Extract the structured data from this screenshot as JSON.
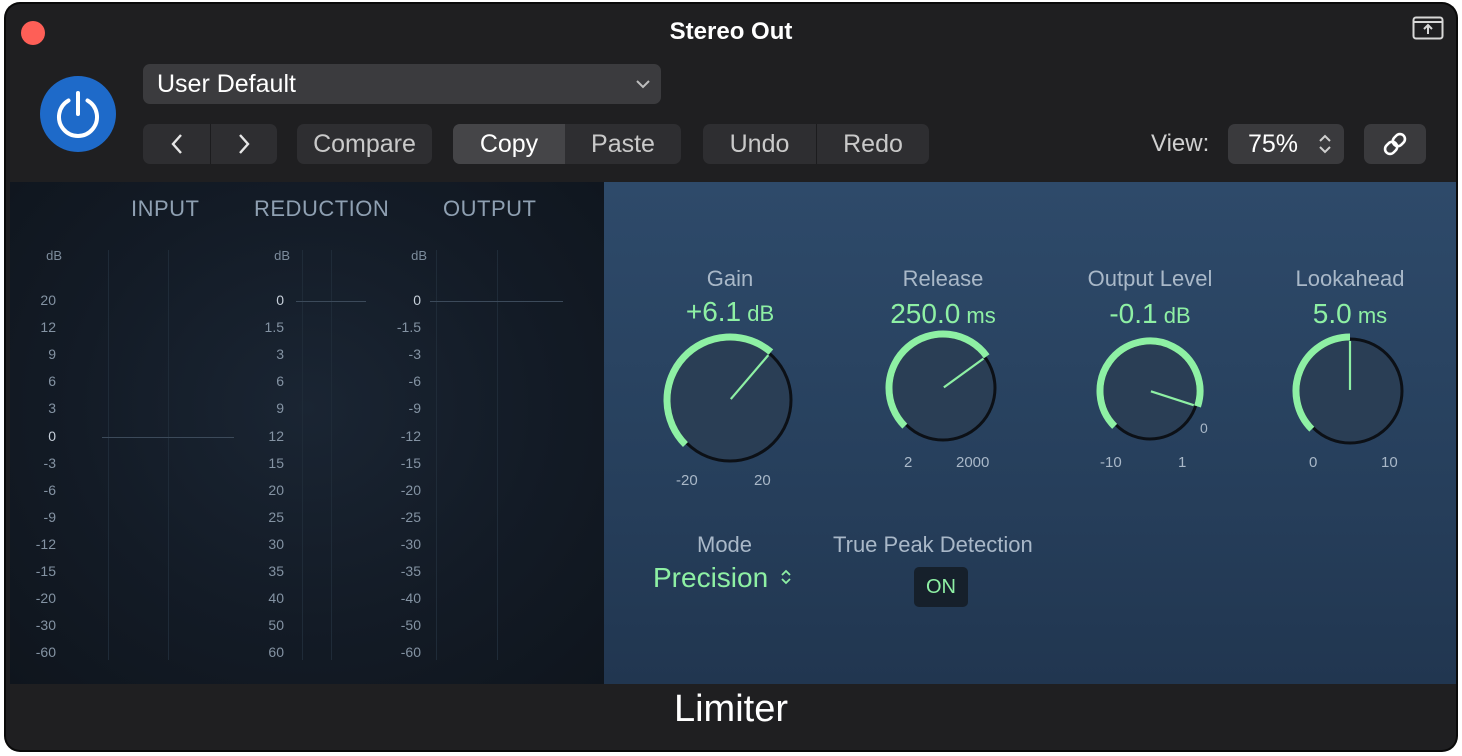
{
  "window": {
    "title": "Stereo Out"
  },
  "header": {
    "preset": "User Default",
    "compare": "Compare",
    "copy": "Copy",
    "paste": "Paste",
    "undo": "Undo",
    "redo": "Redo",
    "view_label": "View:",
    "view_value": "75%"
  },
  "meters": {
    "input_title": "INPUT",
    "reduction_title": "REDUCTION",
    "output_title": "OUTPUT",
    "db_label": "dB",
    "input_scale": [
      "20",
      "12",
      "9",
      "6",
      "3",
      "0",
      "-3",
      "-6",
      "-9",
      "-12",
      "-15",
      "-20",
      "-30",
      "-60"
    ],
    "reduction_scale": [
      "0",
      "1.5",
      "3",
      "6",
      "9",
      "12",
      "15",
      "20",
      "25",
      "30",
      "35",
      "40",
      "50",
      "60"
    ],
    "output_scale": [
      "0",
      "-1.5",
      "-3",
      "-6",
      "-9",
      "-12",
      "-15",
      "-20",
      "-25",
      "-30",
      "-35",
      "-40",
      "-50",
      "-60"
    ]
  },
  "knobs": [
    {
      "label": "Gain",
      "value": "+6.1",
      "unit": "dB",
      "min_label": "-20",
      "max_label": "20",
      "fraction": 0.65
    },
    {
      "label": "Release",
      "value": "250.0",
      "unit": "ms",
      "min_label": "2",
      "max_label": "2000",
      "fraction": 0.7
    },
    {
      "label": "Output Level",
      "value": "-0.1",
      "unit": "dB",
      "min_label": "-10",
      "max_label": "1",
      "fraction": 0.9,
      "extra_label": "0"
    },
    {
      "label": "Lookahead",
      "value": "5.0",
      "unit": "ms",
      "min_label": "0",
      "max_label": "10",
      "fraction": 0.5
    }
  ],
  "mode": {
    "label": "Mode",
    "value": "Precision"
  },
  "true_peak": {
    "label": "True Peak Detection",
    "value": "ON"
  },
  "plugin_name": "Limiter",
  "colors": {
    "accent_green": "#8ef0a4",
    "power_blue": "#1e6ac9",
    "close_red": "#fe5f57"
  },
  "icons": [
    "close-icon",
    "share-icon",
    "power-icon",
    "chevron-down-icon",
    "chevron-left-icon",
    "chevron-right-icon",
    "up-down-chevron-icon",
    "link-icon"
  ]
}
